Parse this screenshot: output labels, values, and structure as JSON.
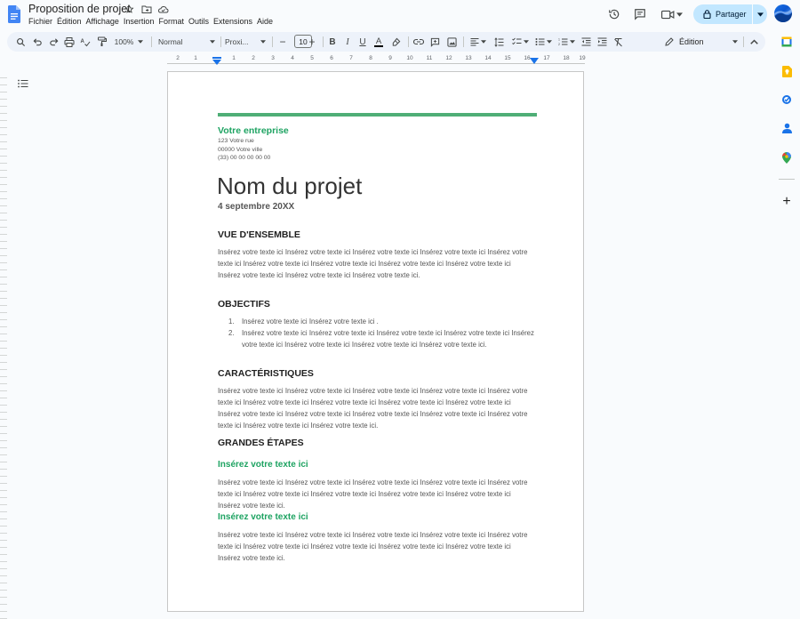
{
  "document": {
    "title": "Proposition de projet"
  },
  "menu": [
    "Fichier",
    "Édition",
    "Affichage",
    "Insertion",
    "Format",
    "Outils",
    "Extensions",
    "Aide"
  ],
  "share": {
    "label": "Partager"
  },
  "toolbar": {
    "zoom": "100%",
    "style": "Normal",
    "font": "Proxi...",
    "font_size": "10",
    "mode": "Édition"
  },
  "ruler": {
    "numbers": [
      "2",
      "1",
      "1",
      "2",
      "3",
      "4",
      "5",
      "6",
      "7",
      "8",
      "9",
      "10",
      "11",
      "12",
      "13",
      "14",
      "15",
      "16",
      "17",
      "18",
      "19"
    ]
  },
  "colors": {
    "accent_green": "#1ea362",
    "bar_green": "#4fae76",
    "share_bg": "#c2e7ff"
  },
  "page": {
    "company": "Votre entreprise",
    "address": [
      "123 Votre rue",
      "00000 Votre ville",
      "(33) 00 00 00 00 00"
    ],
    "project_title": "Nom du projet",
    "date": "4 septembre 20XX",
    "overview_heading": "VUE D'ENSEMBLE",
    "overview_text": "Insérez votre texte ici Insérez votre texte ici Insérez votre texte ici Insérez votre texte ici Insérez votre texte ici Insérez votre texte ici Insérez votre texte ici Insérez votre texte ici Insérez votre texte ici Insérez votre texte ici Insérez votre texte ici Insérez votre texte ici.",
    "objectives_heading": "OBJECTIFS",
    "objectives": [
      {
        "num": "1.",
        "text": "Insérez votre texte ici Insérez votre texte ici ."
      },
      {
        "num": "2.",
        "text": "Insérez votre texte ici Insérez votre texte ici Insérez votre texte ici Insérez votre texte ici Insérez votre texte ici Insérez votre texte ici Insérez votre texte ici Insérez votre texte ici."
      }
    ],
    "features_heading": "CARACTÉRISTIQUES",
    "features_text": "Insérez votre texte ici Insérez votre texte ici Insérez votre texte ici Insérez votre texte ici Insérez votre texte ici Insérez votre texte ici Insérez votre texte ici Insérez votre texte ici Insérez votre texte ici Insérez votre texte ici Insérez votre texte ici Insérez votre texte ici Insérez votre texte ici Insérez votre texte ici Insérez votre texte ici Insérez votre texte ici.",
    "milestones_heading": "GRANDES ÉTAPES",
    "milestones": [
      {
        "title": "Insérez votre texte ici",
        "text": "Insérez votre texte ici Insérez votre texte ici Insérez votre texte ici Insérez votre texte ici Insérez votre texte ici Insérez votre texte ici Insérez votre texte ici Insérez votre texte ici Insérez votre texte ici Insérez votre texte ici."
      },
      {
        "title": "Insérez votre texte ici",
        "text": "Insérez votre texte ici Insérez votre texte ici Insérez votre texte ici Insérez votre texte ici Insérez votre texte ici Insérez votre texte ici Insérez votre texte ici Insérez votre texte ici Insérez votre texte ici Insérez votre texte ici."
      }
    ]
  }
}
